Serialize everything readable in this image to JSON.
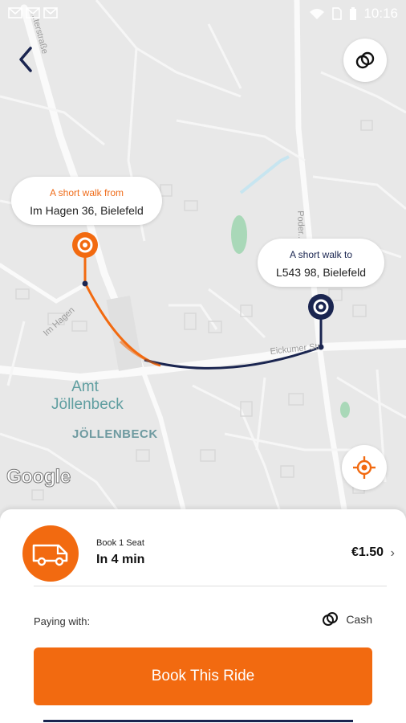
{
  "status_bar": {
    "time": "10:16"
  },
  "map": {
    "pickup": {
      "subtitle": "A short walk from",
      "address": "Im Hagen 36, Bielefeld"
    },
    "dropoff": {
      "subtitle": "A short walk to",
      "address": "L543 98, Bielefeld"
    },
    "labels": {
      "amt": "Amt Jöllenbeck",
      "district": "JÖLLENBECK"
    },
    "streets": {
      "im_hagen": "Im Hagen",
      "eickumer": "Eickumer Str",
      "upper_left": "...terstraße",
      "right": "Poder..."
    },
    "attribution": "Google"
  },
  "ride": {
    "label": "Book 1 Seat",
    "eta": "In 4 min",
    "price": "€1.50"
  },
  "payment": {
    "label": "Paying with:",
    "method": "Cash"
  },
  "book_button": "Book This Ride",
  "colors": {
    "accent": "#f26a10",
    "navy": "#1a2550"
  }
}
